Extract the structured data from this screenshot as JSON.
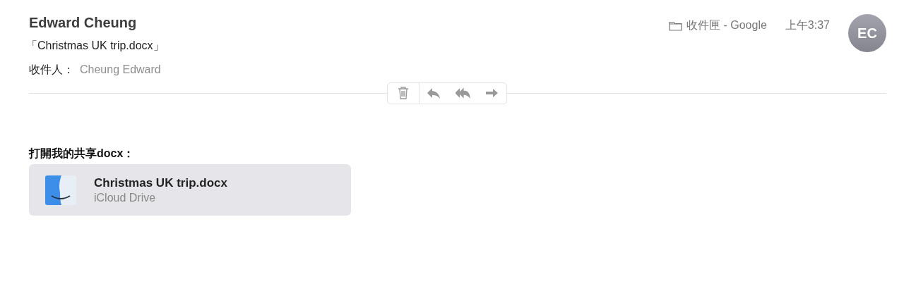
{
  "message": {
    "sender": "Edward Cheung",
    "subject": "「Christmas UK trip.docx」",
    "recipients_label": "收件人：",
    "recipient": "Cheung Edward",
    "mailbox": "收件匣 - Google",
    "time": "上午3:37",
    "avatar_initials": "EC"
  },
  "toolbar": [
    {
      "kind": "delete"
    },
    {
      "kind": "reply"
    },
    {
      "kind": "reply_all"
    },
    {
      "kind": "forward"
    }
  ],
  "body": {
    "text": "打開我的共享docx：",
    "attachment": {
      "name": "Christmas UK trip.docx",
      "location": "iCloud Drive"
    }
  }
}
